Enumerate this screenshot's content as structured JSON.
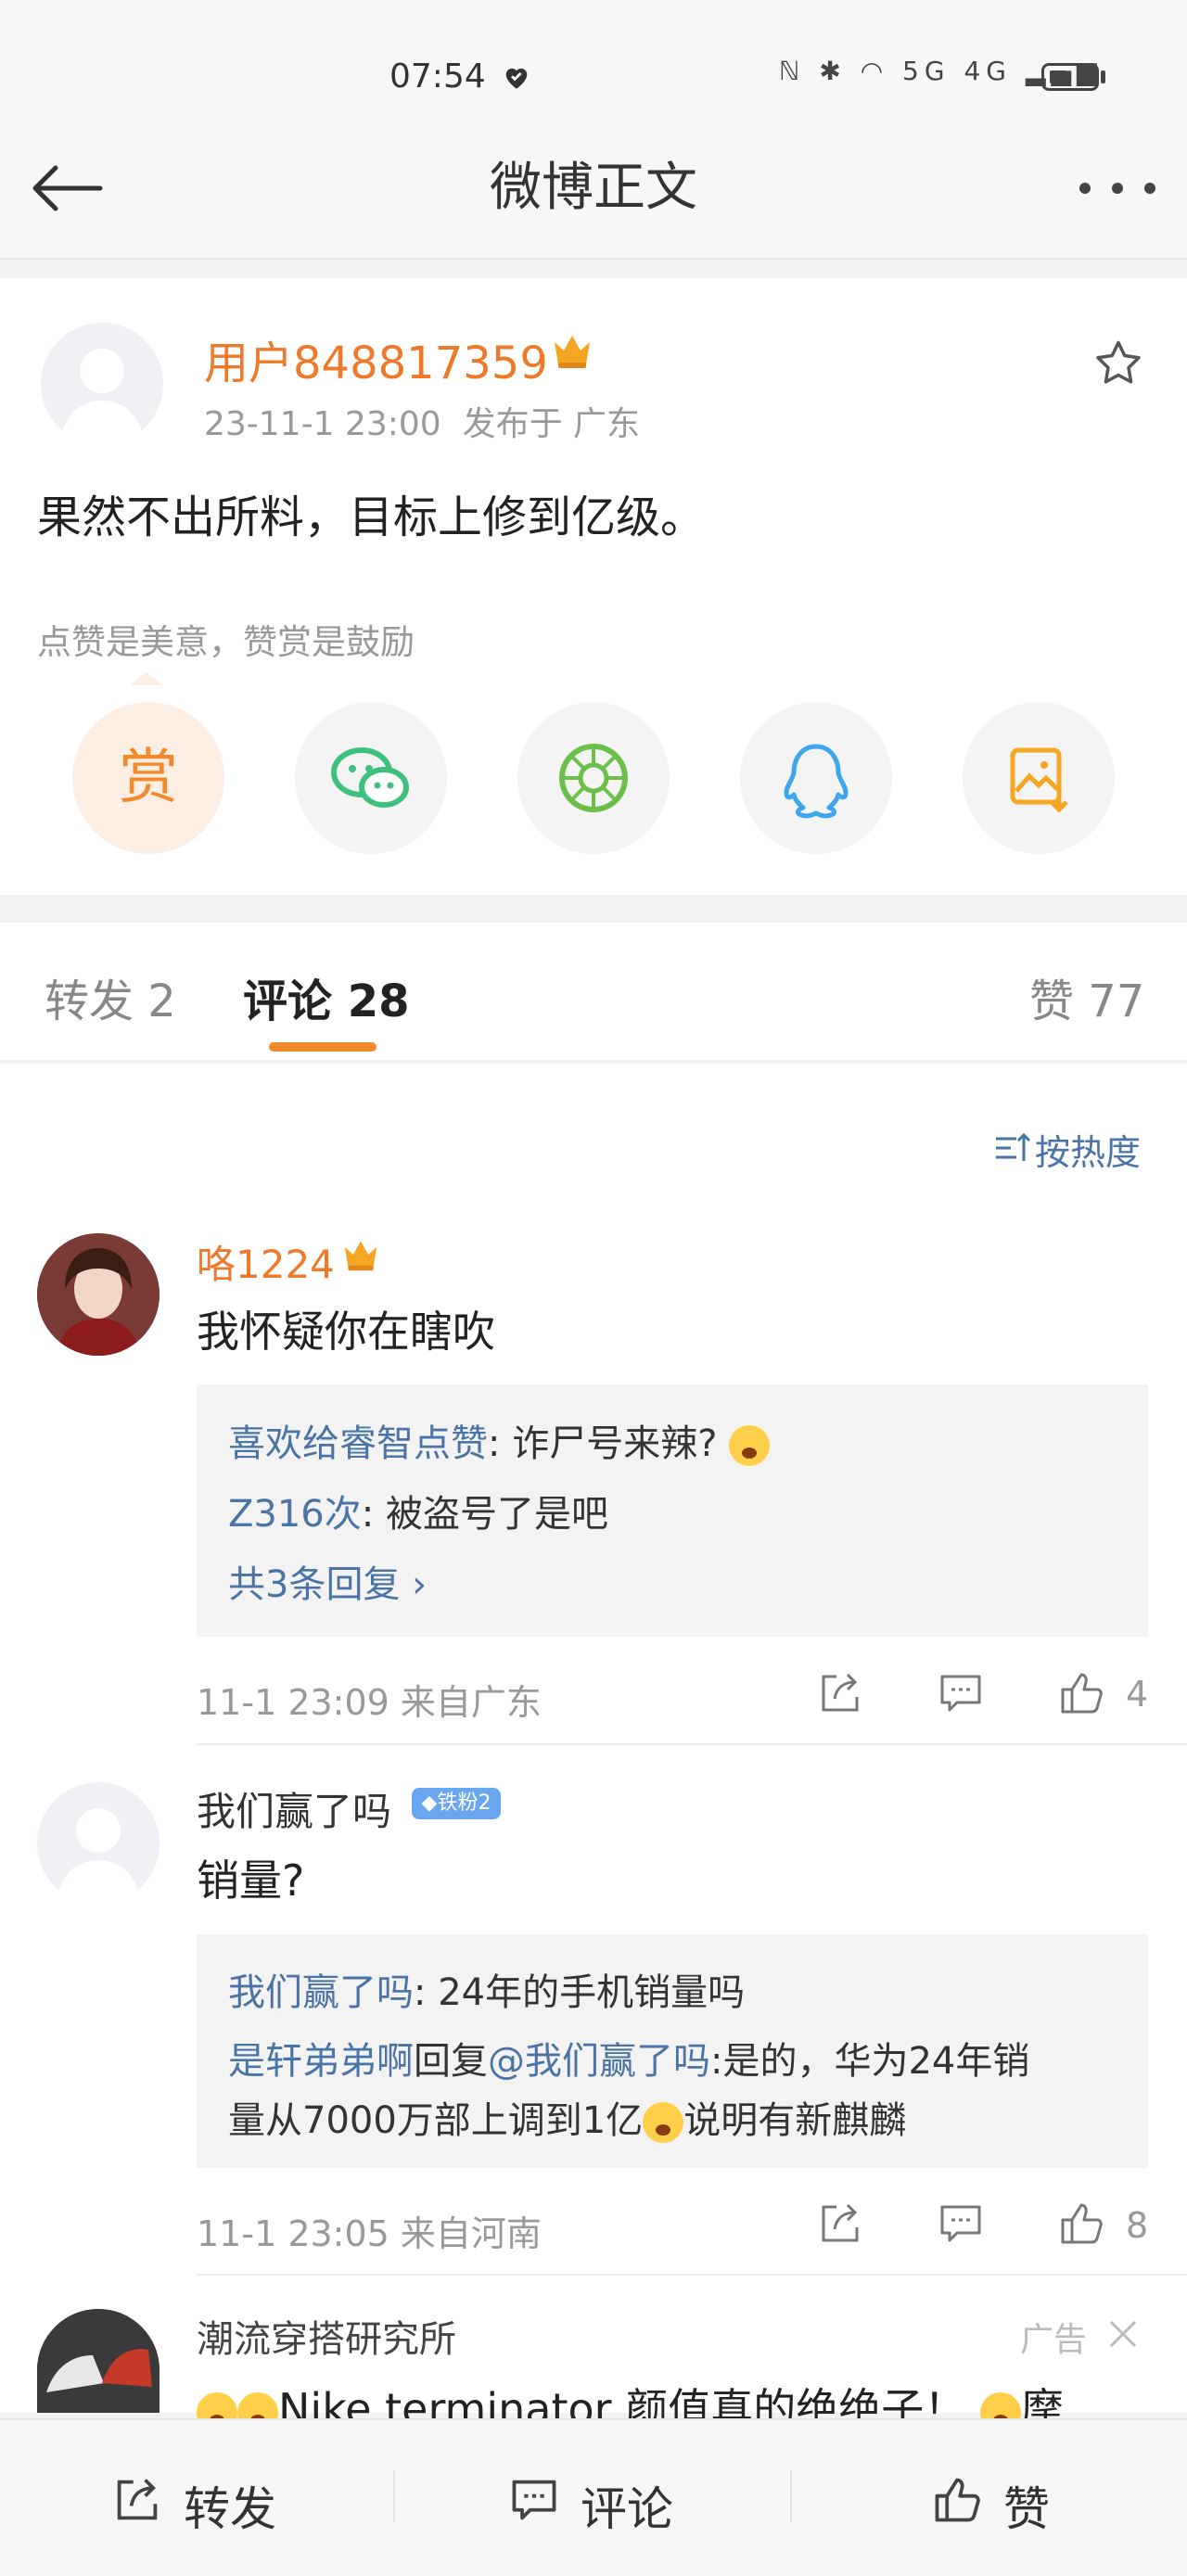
{
  "status_bar": {
    "time": "07:54",
    "network": "5G 4G"
  },
  "header": {
    "title": "微博正文"
  },
  "post": {
    "author": "用户848817359",
    "time": "23-11-1 23:00",
    "location": "发布于 广东",
    "text": "果然不出所料，目标上修到亿级。",
    "reward_hint": "点赞是美意，赞赏是鼓励",
    "reward_label": "赏"
  },
  "tabs": {
    "repost": "转发 2",
    "comments": "评论 28",
    "likes": "赞 77"
  },
  "sort": {
    "label": "按热度"
  },
  "comments": [
    {
      "name": "咯1224",
      "text": "我怀疑你在瞎吹",
      "replies": [
        {
          "user": "喜欢给睿智点赞",
          "text": ": 诈尸号来辣? "
        },
        {
          "user": "Z316次",
          "text": ": 被盗号了是吧"
        }
      ],
      "more_replies": "共3条回复 ›",
      "meta": "11-1 23:09  来自广东",
      "likes": "4"
    },
    {
      "name": "我们赢了吗",
      "badge": "铁粉2",
      "text": "销量?",
      "replies": [
        {
          "user": "我们赢了吗",
          "text": ": 24年的手机销量吗"
        }
      ],
      "reply2": {
        "user": "是轩弟弟啊",
        "mid": "回复",
        "mention": "@我们赢了吗",
        "text_line1": ":是的，华为24年销",
        "text_line2": "量从7000万部上调到1亿",
        "text_line3": "说明有新麒麟"
      },
      "meta": "11-1 23:05  来自河南",
      "likes": "8"
    }
  ],
  "ad": {
    "name": "潮流穿搭研究所",
    "label": "广告",
    "text": "Nike terminator 颜值真的绝绝子！",
    "text_tail": "摩"
  },
  "bottom_bar": {
    "repost": "转发",
    "comment": "评论",
    "like": "赞"
  }
}
